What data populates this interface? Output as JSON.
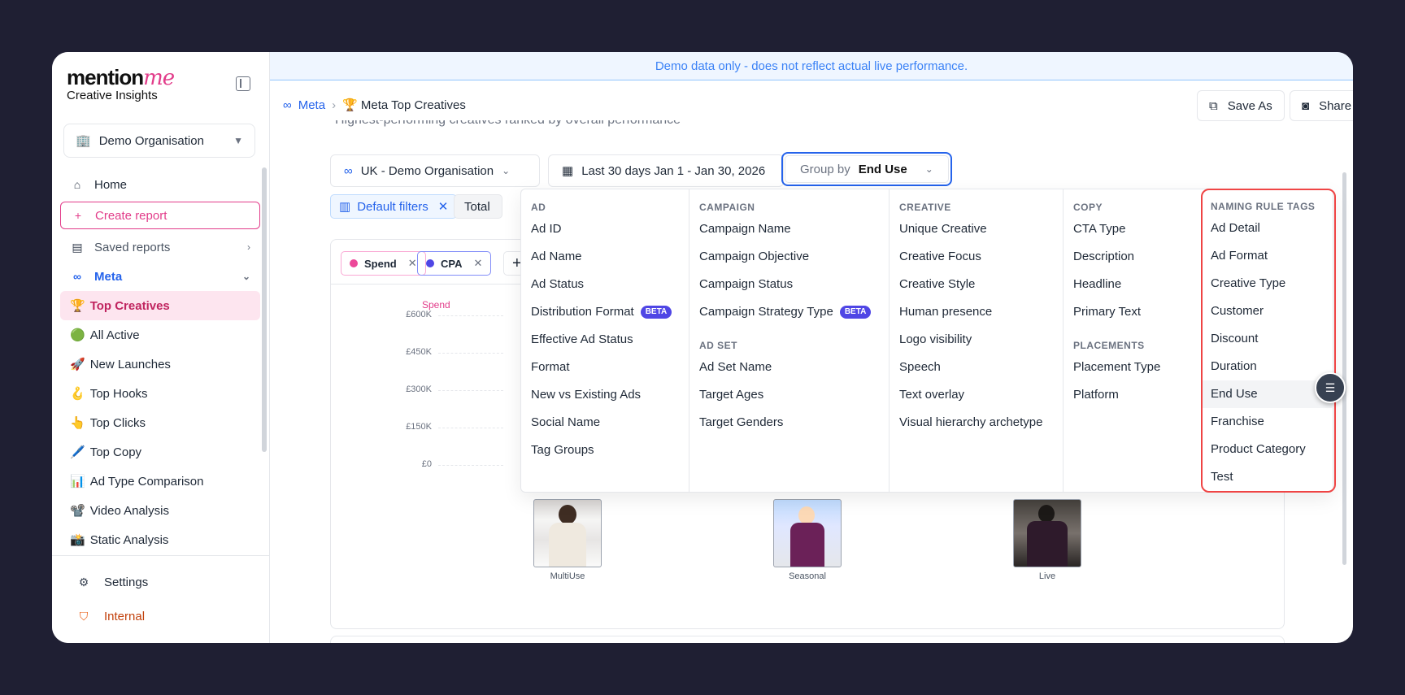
{
  "logo": {
    "brand": "mention",
    "brand_accent": "me",
    "product": "Creative Insights"
  },
  "sidebar": {
    "org": "Demo Organisation",
    "home": "Home",
    "create_report": "Create report",
    "saved_reports": "Saved reports",
    "meta": "Meta",
    "reports": [
      {
        "emoji": "🏆",
        "label": "Top Creatives"
      },
      {
        "emoji": "🟢",
        "label": "All Active"
      },
      {
        "emoji": "🚀",
        "label": "New Launches"
      },
      {
        "emoji": "🪝",
        "label": "Top Hooks"
      },
      {
        "emoji": "👆",
        "label": "Top Clicks"
      },
      {
        "emoji": "🖊️",
        "label": "Top Copy"
      },
      {
        "emoji": "📊",
        "label": "Ad Type Comparison"
      },
      {
        "emoji": "📽️",
        "label": "Video Analysis"
      },
      {
        "emoji": "📸",
        "label": "Static Analysis"
      }
    ],
    "settings": "Settings",
    "internal": "Internal"
  },
  "banner": "Demo data only - does not reflect actual live performance.",
  "breadcrumb": {
    "parent": "Meta",
    "current": "🏆 Meta Top Creatives"
  },
  "actions": {
    "save_as": "Save As",
    "share": "Share"
  },
  "subtitle": "Highest-performing creatives ranked by overall performance",
  "filters": {
    "account": "UK - Demo Organisation",
    "date_range": "Last 30 days Jan 1 - Jan 30, 2026",
    "group_by_label": "Group by",
    "group_by_value": "End Use",
    "default_filters": "Default filters",
    "total_chip": "Total P"
  },
  "metrics": [
    {
      "label": "Spend",
      "color": "#ec4899"
    },
    {
      "label": "CPA",
      "color": "#4f46e5"
    }
  ],
  "chart": {
    "series_label": "Spend",
    "yticks": [
      "£600K",
      "£450K",
      "£300K",
      "£150K",
      "£0"
    ]
  },
  "thumbnails": [
    "MultiUse",
    "Seasonal",
    "Live"
  ],
  "dropdown": {
    "ad": {
      "header": "AD",
      "items": [
        "Ad ID",
        "Ad Name",
        "Ad Status",
        "Distribution Format",
        "Effective Ad Status",
        "Format",
        "New vs Existing Ads",
        "Social Name",
        "Tag Groups"
      ],
      "beta_item": "Distribution Format"
    },
    "campaign": {
      "header": "CAMPAIGN",
      "items": [
        "Campaign Name",
        "Campaign Objective",
        "Campaign Status",
        "Campaign Strategy Type"
      ]
    },
    "adset": {
      "header": "AD SET",
      "items": [
        "Ad Set Name",
        "Target Ages",
        "Target Genders"
      ]
    },
    "creative": {
      "header": "CREATIVE",
      "items": [
        "Unique Creative",
        "Creative Focus",
        "Creative Style",
        "Human presence",
        "Logo visibility",
        "Speech",
        "Text overlay",
        "Visual hierarchy archetype"
      ]
    },
    "copy": {
      "header": "COPY",
      "items": [
        "CTA Type",
        "Description",
        "Headline",
        "Primary Text"
      ]
    },
    "placements": {
      "header": "PLACEMENTS",
      "items": [
        "Placement Type",
        "Platform"
      ]
    },
    "naming": {
      "header": "NAMING RULE TAGS",
      "items": [
        "Ad Detail",
        "Ad Format",
        "Creative Type",
        "Customer",
        "Discount",
        "Duration",
        "End Use",
        "Franchise",
        "Product Category",
        "Test"
      ],
      "selected": "End Use"
    },
    "beta": "BETA"
  },
  "colors": {
    "accent": "#2563eb",
    "brand_pink": "#e23c8a",
    "highlight": "#ef4444"
  }
}
